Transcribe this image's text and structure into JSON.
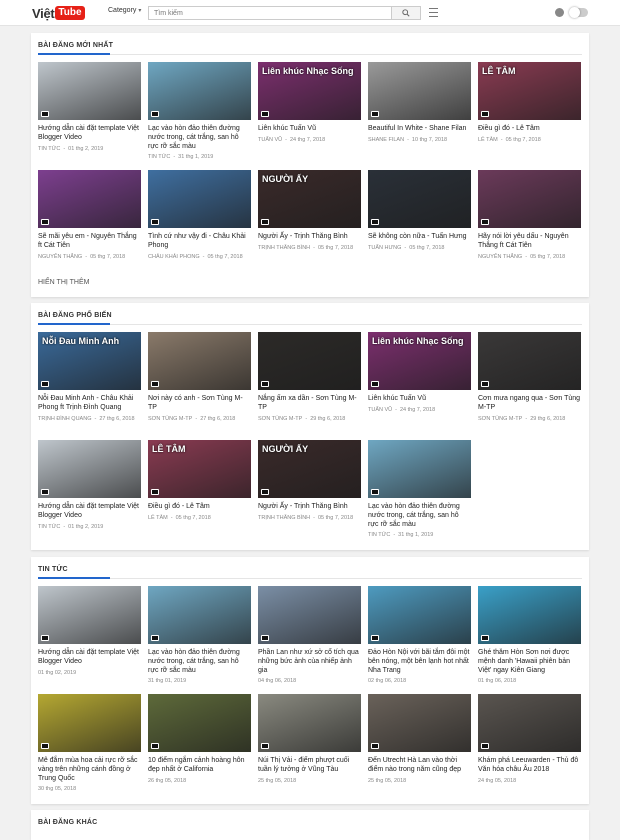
{
  "header": {
    "logo_text": "Việt",
    "logo_badge": "Tube",
    "category_label": "Category",
    "search_placeholder": "Tìm kiếm",
    "icons": [
      "search-icon",
      "menu-icon",
      "bell-icon",
      "toggle-icon"
    ]
  },
  "sections": [
    {
      "title": "BÀI ĐĂNG MỚI NHẤT",
      "more": "HIỂN THỊ THÊM",
      "cards": [
        {
          "title": "Hướng dẫn cài đặt template Việt Blogger Video",
          "author": "TIN TỨC",
          "date": "01 thg 2, 2019",
          "color": "#bfc6cc",
          "overlay": ""
        },
        {
          "title": "Lạc vào hòn đảo thiên đường nước trong, cát trắng, san hô rực rỡ sắc màu",
          "author": "TIN TỨC",
          "date": "31 thg 1, 2019",
          "color": "#6fa7c2",
          "overlay": ""
        },
        {
          "title": "Liên khúc Tuấn Vũ",
          "author": "TUẤN VŨ",
          "date": "24 thg 7, 2018",
          "color": "#7c2f6e",
          "overlay": "Liên khúc Nhạc Sống"
        },
        {
          "title": "Beautiful In White - Shane Filan",
          "author": "SHANE FILAN",
          "date": "10 thg 7, 2018",
          "color": "#9a9a9a",
          "overlay": ""
        },
        {
          "title": "Điều gì đó - Lê Tâm",
          "author": "LÊ TÂM",
          "date": "05 thg 7, 2018",
          "color": "#8a3b52",
          "overlay": "LÊ TÂM"
        },
        {
          "title": "Sẽ mãi yêu em - Nguyên Thắng ft Cát Tiên",
          "author": "NGUYỄN THẮNG",
          "date": "05 thg 7, 2018",
          "color": "#7d3f8f",
          "overlay": ""
        },
        {
          "title": "Tình cứ như vậy đi - Châu Khải Phong",
          "author": "CHÂU KHẢI PHONG",
          "date": "05 thg 7, 2018",
          "color": "#3f6fa0",
          "overlay": ""
        },
        {
          "title": "Người Ấy - Trịnh Thăng Bình",
          "author": "TRỊNH THĂNG BÌNH",
          "date": "05 thg 7, 2018",
          "color": "#3a2a2a",
          "overlay": "NGƯỜI ẤY"
        },
        {
          "title": "Sẽ không còn nữa - Tuấn Hưng",
          "author": "TUẤN HƯNG",
          "date": "05 thg 7, 2018",
          "color": "#2a3038",
          "overlay": ""
        },
        {
          "title": "Hãy nói lời yêu dấu - Nguyên Thắng ft Cát Tiên",
          "author": "NGUYỄN THẮNG",
          "date": "05 thg 7, 2018",
          "color": "#6b3a5a",
          "overlay": ""
        }
      ]
    },
    {
      "title": "BÀI ĐĂNG PHỔ BIẾN",
      "more": "",
      "cards": [
        {
          "title": "Nỗi Đau Minh Anh - Châu Khải Phong ft Trịnh Đình Quang",
          "author": "TRỊNH ĐÌNH QUANG",
          "date": "27 thg 6, 2018",
          "color": "#3a6a9a",
          "overlay": "Nỗi Đau Minh Anh"
        },
        {
          "title": "Nơi này có anh - Sơn Tùng M-TP",
          "author": "SƠN TÙNG M-TP",
          "date": "27 thg 6, 2018",
          "color": "#8a7a6a",
          "overlay": ""
        },
        {
          "title": "Nắng ấm xa dần - Sơn Tùng M-TP",
          "author": "SƠN TÙNG M-TP",
          "date": "29 thg 6, 2018",
          "color": "#2c2a28",
          "overlay": ""
        },
        {
          "title": "Liên khúc Tuấn Vũ",
          "author": "TUẤN VŨ",
          "date": "24 thg 7, 2018",
          "color": "#7c2f6e",
          "overlay": "Liên khúc Nhạc Sống"
        },
        {
          "title": "Cơn mưa ngang qua - Sơn Tùng M-TP",
          "author": "SƠN TÙNG M-TP",
          "date": "29 thg 6, 2018",
          "color": "#3a3838",
          "overlay": ""
        },
        {
          "title": "Hướng dẫn cài đặt template Việt Blogger Video",
          "author": "TIN TỨC",
          "date": "01 thg 2, 2019",
          "color": "#bfc6cc",
          "overlay": ""
        },
        {
          "title": "Điều gì đó - Lê Tâm",
          "author": "LÊ TÂM",
          "date": "05 thg 7, 2018",
          "color": "#8a3b52",
          "overlay": "LÊ TÂM"
        },
        {
          "title": "Người Ấy - Trịnh Thăng Bình",
          "author": "TRỊNH THĂNG BÌNH",
          "date": "05 thg 7, 2018",
          "color": "#3a2a2a",
          "overlay": "NGƯỜI ẤY"
        },
        {
          "title": "Lạc vào hòn đảo thiên đường nước trong, cát trắng, san hô rực rỡ sắc màu",
          "author": "TIN TỨC",
          "date": "31 thg 1, 2019",
          "color": "#6fa7c2",
          "overlay": ""
        }
      ]
    },
    {
      "title": "TIN TỨC",
      "more": "",
      "cards": [
        {
          "title": "Hướng dẫn cài đặt template Việt Blogger Video",
          "author": "",
          "date": "01 thg 02, 2019",
          "color": "#bfc6cc",
          "overlay": ""
        },
        {
          "title": "Lạc vào hòn đảo thiên đường nước trong, cát trắng, san hô rực rỡ sắc màu",
          "author": "",
          "date": "31 thg 01, 2019",
          "color": "#6fa7c2",
          "overlay": ""
        },
        {
          "title": "Phần Lan như xứ sở cổ tích qua những bức ảnh của nhiếp ảnh gia",
          "author": "",
          "date": "04 thg 06, 2018",
          "color": "#7b8fa6",
          "overlay": ""
        },
        {
          "title": "Đảo Hòn Nội với bãi tắm đôi một bên nóng, một bên lạnh hot nhất Nha Trang",
          "author": "",
          "date": "02 thg 06, 2018",
          "color": "#4e9bc0",
          "overlay": ""
        },
        {
          "title": "Ghé thăm Hòn Sơn nơi được mệnh danh 'Hawaii phiên bản Việt' ngay Kiên Giang",
          "author": "",
          "date": "01 thg 06, 2018",
          "color": "#3aa0c8",
          "overlay": ""
        },
        {
          "title": "Mê đắm mùa hoa cải rực rỡ sắc vàng trên những cánh đồng ở Trung Quốc",
          "author": "",
          "date": "30 thg 05, 2018",
          "color": "#b5a832",
          "overlay": ""
        },
        {
          "title": "10 điểm ngắm cảnh hoàng hôn đẹp nhất ở California",
          "author": "",
          "date": "26 thg 05, 2018",
          "color": "#5e6a3a",
          "overlay": ""
        },
        {
          "title": "Núi Thị Vải - điểm phượt cuối tuần lý tưởng ở Vũng Tàu",
          "author": "",
          "date": "25 thg 05, 2018",
          "color": "#8a8a80",
          "overlay": ""
        },
        {
          "title": "Đến Utrecht Hà Lan vào thời điểm nào trong năm cũng đẹp",
          "author": "",
          "date": "25 thg 05, 2018",
          "color": "#6a625a",
          "overlay": ""
        },
        {
          "title": "Khám phá Leeuwarden - Thủ đô Văn hóa châu Âu 2018",
          "author": "",
          "date": "24 thg 05, 2018",
          "color": "#5a5550",
          "overlay": ""
        }
      ]
    },
    {
      "title": "BÀI ĐĂNG KHÁC",
      "more": "",
      "cards": []
    }
  ]
}
